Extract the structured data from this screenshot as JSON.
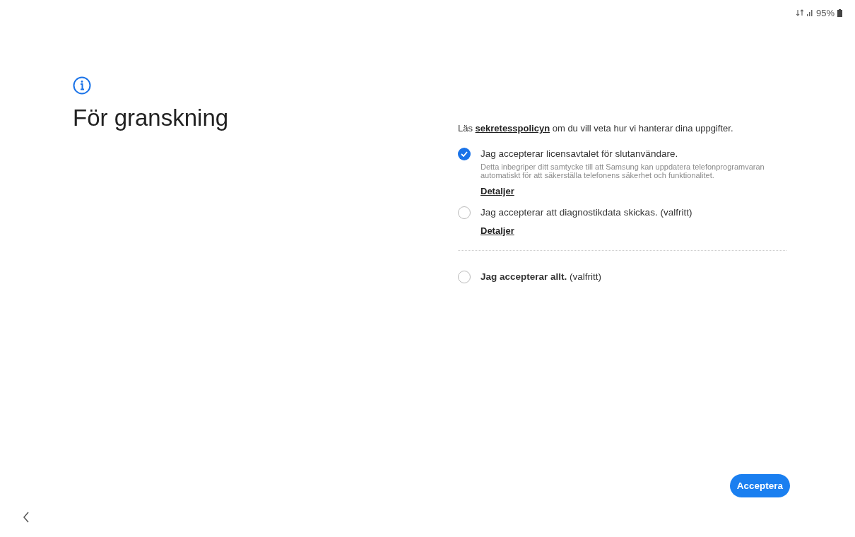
{
  "status_bar": {
    "battery": "95%"
  },
  "title": "För granskning",
  "intro": {
    "before": "Läs ",
    "link": "sekretesspolicyn",
    "after": " om du vill veta hur vi hanterar dina uppgifter."
  },
  "options": [
    {
      "label": "Jag accepterar licensavtalet för slutanvändare.",
      "description": "Detta inbegriper ditt samtycke till att Samsung kan uppdatera telefonprogramvaran automatiskt för att säkerställa telefonens säkerhet och funktionalitet.",
      "details": "Detaljer",
      "checked": true
    },
    {
      "label": "Jag accepterar att diagnostikdata skickas. (valfritt)",
      "details": "Detaljer",
      "checked": false
    },
    {
      "label": "**Jag accepterar allt.** (valfritt)",
      "checked": false,
      "divider_before": true
    }
  ],
  "accept_button": "Acceptera"
}
